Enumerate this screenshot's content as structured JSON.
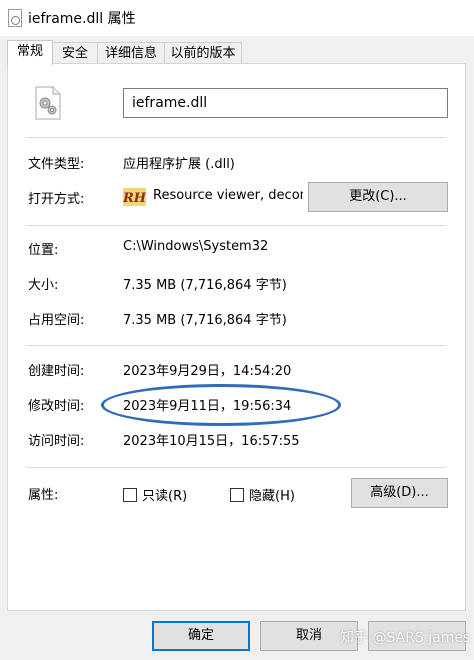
{
  "window": {
    "title": "ieframe.dll 属性"
  },
  "tabs": [
    {
      "label": "常规"
    },
    {
      "label": "安全"
    },
    {
      "label": "详细信息"
    },
    {
      "label": "以前的版本"
    }
  ],
  "file": {
    "name": "ieframe.dll"
  },
  "props": {
    "file_type": {
      "label": "文件类型:",
      "value": "应用程序扩展 (.dll)"
    },
    "open_with": {
      "label": "打开方式:",
      "app_icon_text": "RH",
      "value": "Resource viewer, decom",
      "change_button": "更改(C)..."
    },
    "location": {
      "label": "位置:",
      "value": "C:\\Windows\\System32"
    },
    "size": {
      "label": "大小:",
      "value": "7.35 MB (7,716,864 字节)"
    },
    "size_on_disk": {
      "label": "占用空间:",
      "value": "7.35 MB (7,716,864 字节)"
    },
    "created": {
      "label": "创建时间:",
      "value": "2023年9月29日，14:54:20"
    },
    "modified": {
      "label": "修改时间:",
      "value": "2023年9月11日，19:56:34"
    },
    "accessed": {
      "label": "访问时间:",
      "value": "2023年10月15日，16:57:55"
    },
    "attributes": {
      "label": "属性:",
      "readonly": "只读(R)",
      "hidden": "隐藏(H)",
      "advanced_button": "高级(D)..."
    }
  },
  "buttons": {
    "ok": "确定",
    "cancel": "取消"
  },
  "watermark": "知乎 @SARS james",
  "colors": {
    "highlight_ellipse": "#2f6db8",
    "default_button_border": "#0078d7"
  }
}
